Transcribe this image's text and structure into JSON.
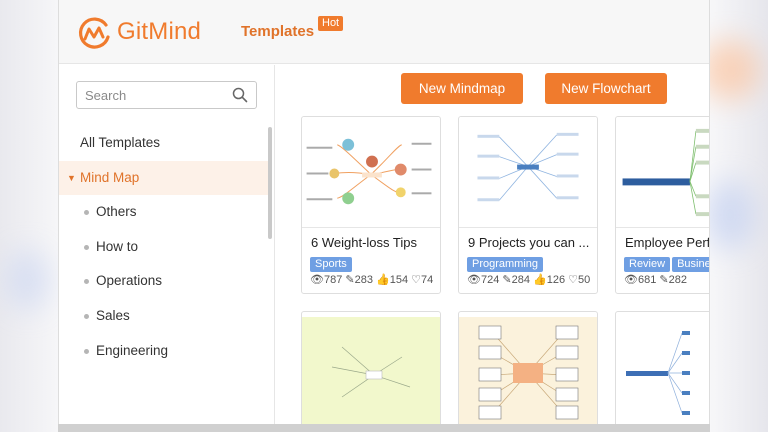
{
  "app": {
    "logo_text": "GitMind",
    "brand_color": "#f07b2d"
  },
  "nav": {
    "templates_label": "Templates",
    "hot_badge": "Hot"
  },
  "search": {
    "placeholder": "Search",
    "value": ""
  },
  "sidebar": {
    "items": [
      {
        "label": "All Templates",
        "active": false
      },
      {
        "label": "Mind Map",
        "active": true,
        "expanded": true
      },
      {
        "label": "Others",
        "sub": true
      },
      {
        "label": "How to",
        "sub": true
      },
      {
        "label": "Operations",
        "sub": true
      },
      {
        "label": "Sales",
        "sub": true
      },
      {
        "label": "Engineering",
        "sub": true
      }
    ]
  },
  "toolbar": {
    "new_mindmap": "New Mindmap",
    "new_flowchart": "New Flowchart"
  },
  "cards": [
    {
      "title": "6 Weight-loss Tips",
      "tags": [
        "Sports"
      ],
      "views": "787",
      "edits": "283",
      "likes": "154",
      "hearts": "74"
    },
    {
      "title": "9 Projects you can ...",
      "tags": [
        "Programming"
      ],
      "views": "724",
      "edits": "284",
      "likes": "126",
      "hearts": "50"
    },
    {
      "title": "Employee Perfo",
      "tags": [
        "Review",
        "Busine"
      ],
      "views": "681",
      "edits": "282",
      "likes": "",
      "hearts": ""
    },
    {
      "title": "",
      "tags": []
    },
    {
      "title": "",
      "tags": []
    },
    {
      "title": "",
      "tags": []
    }
  ]
}
